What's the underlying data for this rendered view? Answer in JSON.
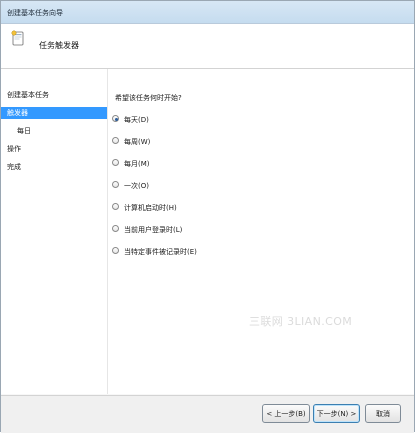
{
  "window": {
    "title": "创建基本任务向导"
  },
  "header": {
    "title": "任务触发器"
  },
  "nav": {
    "items": [
      {
        "label": "创建基本任务",
        "active": false,
        "sub": false
      },
      {
        "label": "触发器",
        "active": true,
        "sub": false
      },
      {
        "label": "每日",
        "active": false,
        "sub": true
      },
      {
        "label": "操作",
        "active": false,
        "sub": false
      },
      {
        "label": "完成",
        "active": false,
        "sub": false
      }
    ]
  },
  "main": {
    "question": "希望该任务何时开始?",
    "options": [
      {
        "label": "每天(D)",
        "checked": true
      },
      {
        "label": "每周(W)",
        "checked": false
      },
      {
        "label": "每月(M)",
        "checked": false
      },
      {
        "label": "一次(O)",
        "checked": false
      },
      {
        "label": "计算机启动时(H)",
        "checked": false
      },
      {
        "label": "当前用户登录时(L)",
        "checked": false
      },
      {
        "label": "当特定事件被记录时(E)",
        "checked": false
      }
    ]
  },
  "watermark": "三联网 3LIAN.COM",
  "footer": {
    "back_label": "< 上一步(B)",
    "next_label": "下一步(N) >",
    "cancel_label": "取消"
  }
}
